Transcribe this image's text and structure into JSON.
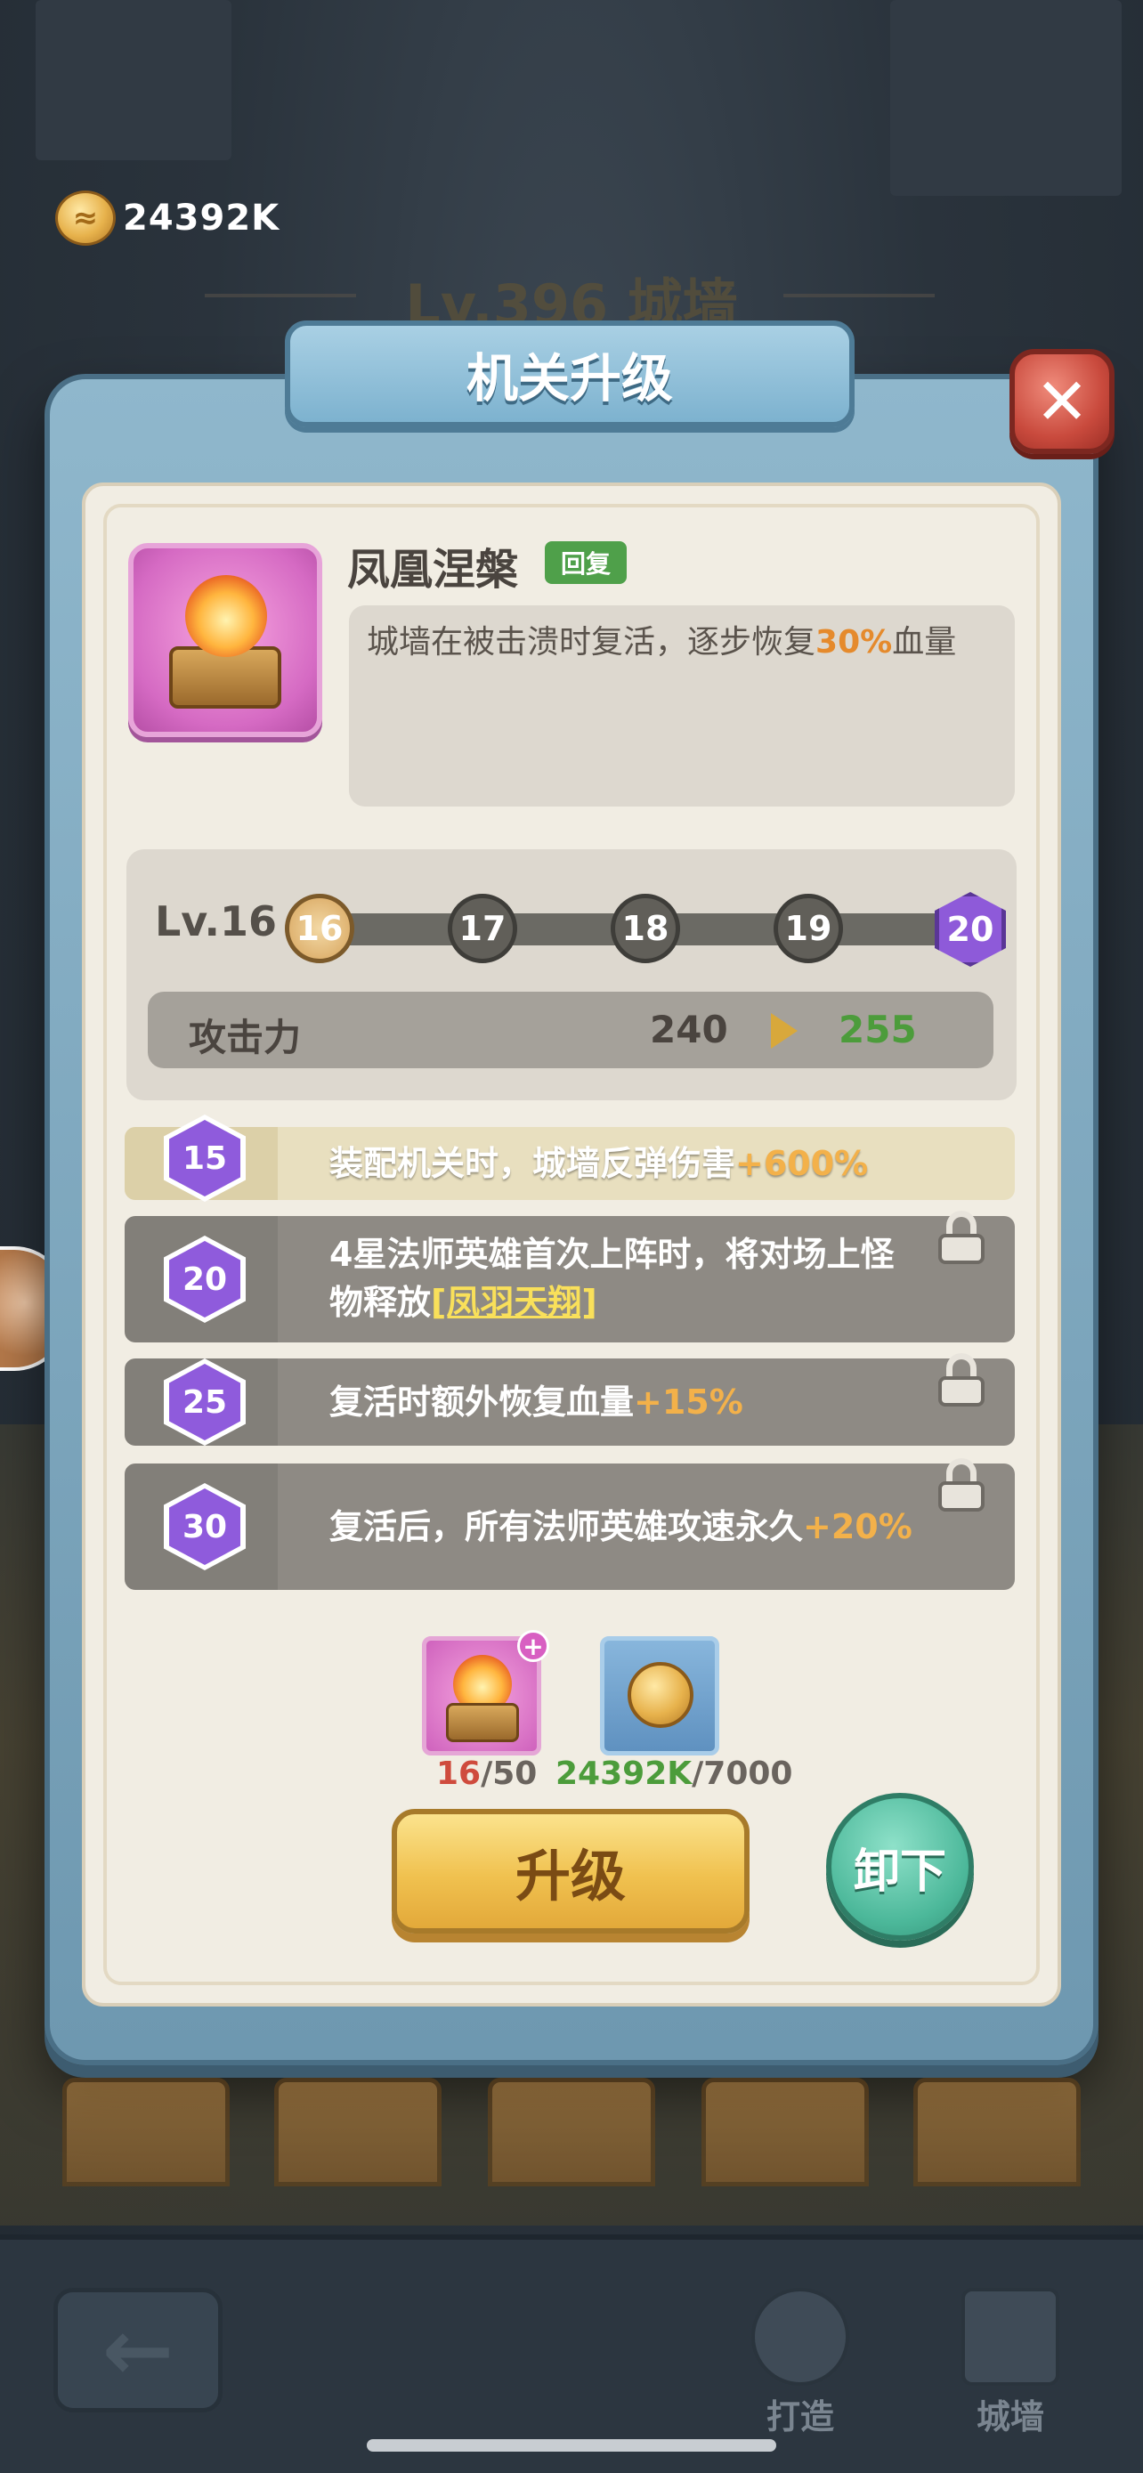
{
  "currency": {
    "amount": "24392K",
    "icon": "gold-coin-icon"
  },
  "background": {
    "title": "Lv.396 城墙"
  },
  "modal": {
    "title": "机关升级",
    "close_icon": "close-icon"
  },
  "skill": {
    "name": "凤凰涅槃",
    "tag": "回复",
    "desc_before": "城墙在被击溃时复活，逐步恢复",
    "desc_highlight": "30%",
    "desc_after": "血量"
  },
  "level": {
    "label": "Lv.16",
    "nodes": [
      "16",
      "17",
      "18",
      "19",
      "20"
    ],
    "current": "16"
  },
  "stat": {
    "name": "攻击力",
    "current": "240",
    "next": "255"
  },
  "perks": [
    {
      "level": "15",
      "text": "装配机关时，城墙反弹伤害",
      "bonus": "+600%",
      "locked": false
    },
    {
      "level": "20",
      "text": "4星法师英雄首次上阵时，将对场上怪物释放",
      "bonus": "[凤羽天翔]",
      "locked": true
    },
    {
      "level": "25",
      "text": "复活时额外恢复血量",
      "bonus": "+15%",
      "locked": true
    },
    {
      "level": "30",
      "text": "复活后，所有法师英雄攻速永久",
      "bonus": "+20%",
      "locked": true
    }
  ],
  "costs": {
    "card_have": "16",
    "card_need": "/50",
    "coin_have": "24392K",
    "coin_need": "/7000"
  },
  "buttons": {
    "upgrade": "升级",
    "unequip": "卸下"
  },
  "bottom_nav": {
    "back_icon": "back-arrow-icon",
    "items": [
      {
        "label": "打造",
        "icon": "gear-icon"
      },
      {
        "label": "城墙",
        "icon": "castle-icon"
      }
    ]
  },
  "colors": {
    "accent_orange": "#e58a2c",
    "upgrade_green": "#4c9c3b",
    "perk_purple": "#8f5bdc",
    "tag_green": "#4fa04a"
  }
}
